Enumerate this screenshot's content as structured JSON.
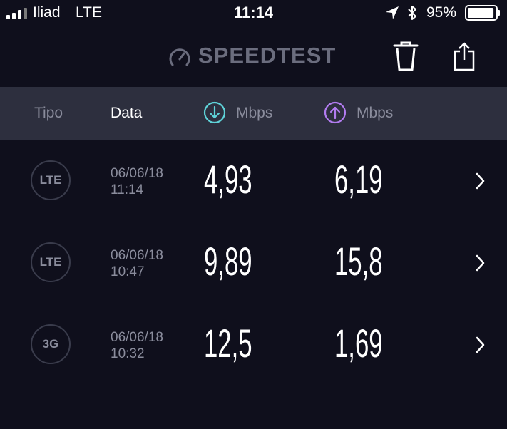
{
  "status_bar": {
    "carrier": "Iliad",
    "network": "LTE",
    "time": "11:14",
    "battery": "95%",
    "battery_level": 0.95
  },
  "header": {
    "app_name": "SPEEDTEST"
  },
  "columns": {
    "type": "Tipo",
    "date": "Data",
    "download_unit": "Mbps",
    "upload_unit": "Mbps"
  },
  "colors": {
    "background": "#0f0f1c",
    "header_band": "#2d2f3e",
    "download_accent": "#5fd3d9",
    "upload_accent": "#b27cf0"
  },
  "results": [
    {
      "type": "LTE",
      "date": "06/06/18",
      "time": "11:14",
      "download": "4,93",
      "upload": "6,19"
    },
    {
      "type": "LTE",
      "date": "06/06/18",
      "time": "10:47",
      "download": "9,89",
      "upload": "15,8"
    },
    {
      "type": "3G",
      "date": "06/06/18",
      "time": "10:32",
      "download": "12,5",
      "upload": "1,69"
    }
  ]
}
